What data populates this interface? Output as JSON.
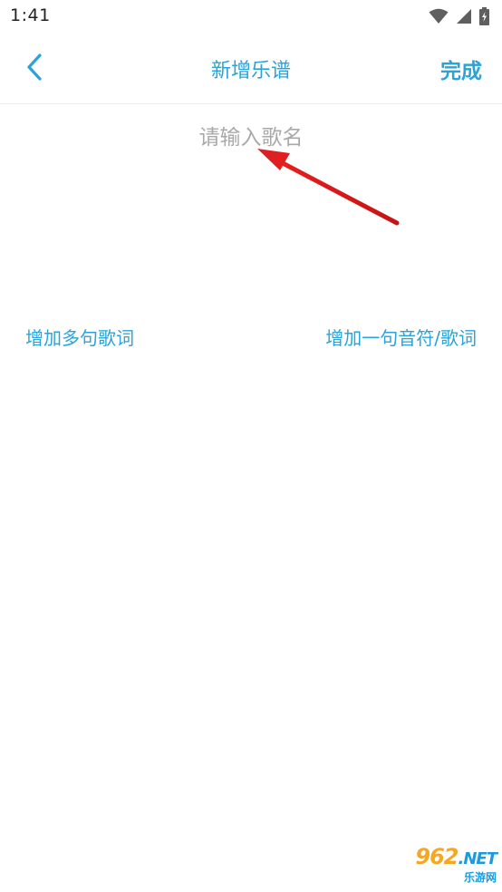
{
  "status_bar": {
    "time": "1:41",
    "icons": [
      "wifi-icon",
      "cellular-signal-icon",
      "battery-charging-icon"
    ]
  },
  "app_bar": {
    "back_icon": "chevron-left-icon",
    "title": "新增乐谱",
    "done_label": "完成"
  },
  "form": {
    "song_name_value": "",
    "song_name_placeholder": "请输入歌名"
  },
  "actions": {
    "add_multiple_lyrics": "增加多句歌词",
    "add_single_note_lyric": "增加一句音符/歌词"
  },
  "watermark": {
    "logo_main": "962",
    "logo_suffix": ".NET",
    "logo_sub": "乐游网"
  },
  "colors": {
    "accent": "#29a3d8",
    "placeholder": "#a9a9a9",
    "annotation_arrow": "#e02020",
    "status_text": "#222222"
  }
}
